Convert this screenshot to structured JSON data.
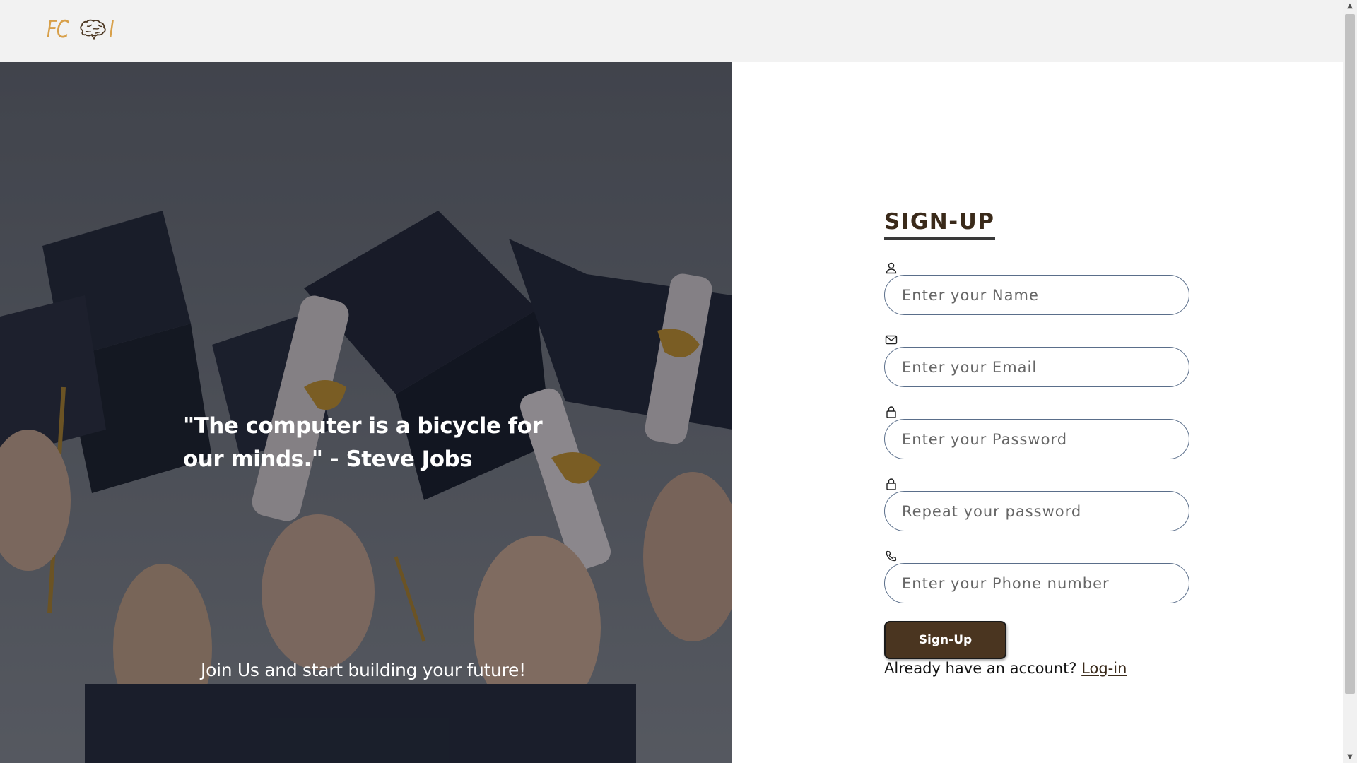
{
  "header": {
    "logo_left": "FC",
    "logo_icon": "brain-icon",
    "logo_right": "I"
  },
  "hero": {
    "quote": "\"The computer is a bicycle for our minds.\" - Steve Jobs",
    "tagline": "Join Us and start building your future!"
  },
  "form": {
    "title": "SIGN-UP",
    "fields": [
      {
        "icon": "user-icon",
        "placeholder": "Enter your Name"
      },
      {
        "icon": "mail-icon",
        "placeholder": "Enter your Email"
      },
      {
        "icon": "lock-icon",
        "placeholder": "Enter your Password"
      },
      {
        "icon": "lock-icon",
        "placeholder": "Repeat your password"
      },
      {
        "icon": "phone-icon",
        "placeholder": "Enter your Phone number"
      }
    ],
    "submit_label": "Sign-Up",
    "login_prompt": "Already have an account?",
    "login_link": "Log-in"
  },
  "colors": {
    "accent_brown": "#4a3520",
    "logo_gold": "#d8a04a",
    "input_border": "#5a6e8a"
  }
}
